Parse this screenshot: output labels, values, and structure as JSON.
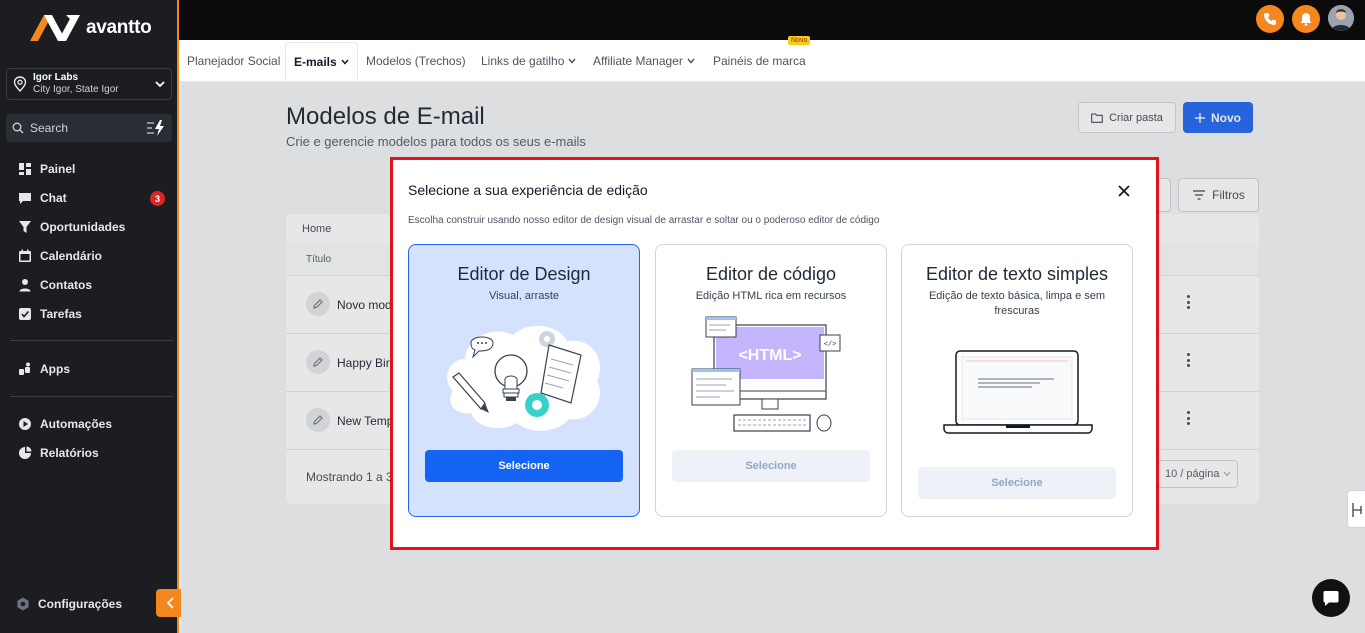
{
  "brand": {
    "name": "avantto",
    "accent": "#f5871f"
  },
  "location": {
    "name": "Igor Labs",
    "address": "City Igor, State Igor"
  },
  "search": {
    "placeholder": "Search"
  },
  "nav": [
    {
      "label": "Painel",
      "icon": "dashboard-icon"
    },
    {
      "label": "Chat",
      "icon": "chat-icon",
      "badge": "3"
    },
    {
      "label": "Oportunidades",
      "icon": "filter-icon"
    },
    {
      "label": "Calendário",
      "icon": "calendar-icon"
    },
    {
      "label": "Contatos",
      "icon": "user-icon"
    },
    {
      "label": "Tarefas",
      "icon": "checkbox-icon"
    }
  ],
  "nav2": [
    {
      "label": "Apps",
      "icon": "apps-icon"
    }
  ],
  "nav3": [
    {
      "label": "Automações",
      "icon": "play-icon"
    },
    {
      "label": "Relatórios",
      "icon": "chart-icon"
    }
  ],
  "settings_label": "Configurações",
  "tabs": [
    {
      "label": "Planejador Social"
    },
    {
      "label": "E-mails",
      "active": true
    },
    {
      "label": "Modelos (Trechos)"
    },
    {
      "label": "Links de gatilho"
    },
    {
      "label": "Affiliate Manager"
    },
    {
      "label": "Painéis de marca",
      "badge": "Novo"
    }
  ],
  "page": {
    "title": "Modelos de E-mail",
    "subtitle": "Crie e gerencie modelos para todos os seus e-mails",
    "create_folder": "Criar pasta",
    "new": "Novo",
    "filters": "Filtros",
    "breadcrumb": "Home",
    "column_title": "Título",
    "rows": [
      "Novo modelo",
      "Happy Birthday",
      "New Template"
    ],
    "footer": "Mostrando 1 a 3",
    "page_size": "10 / página"
  },
  "modal": {
    "title": "Selecione a sua experiência de edição",
    "subtitle": "Escolha construir usando nosso editor de design visual de arrastar e soltar ou o poderoso editor de código",
    "options": [
      {
        "title": "Editor de Design",
        "desc": "Visual, arraste",
        "button": "Selecione",
        "selected": true
      },
      {
        "title": "Editor de código",
        "desc": "Edição HTML rica em recursos",
        "button": "Selecione",
        "code_label": "<HTML>"
      },
      {
        "title": "Editor de texto simples",
        "desc": "Edição de texto básica, limpa e sem frescuras",
        "button": "Selecione"
      }
    ]
  }
}
